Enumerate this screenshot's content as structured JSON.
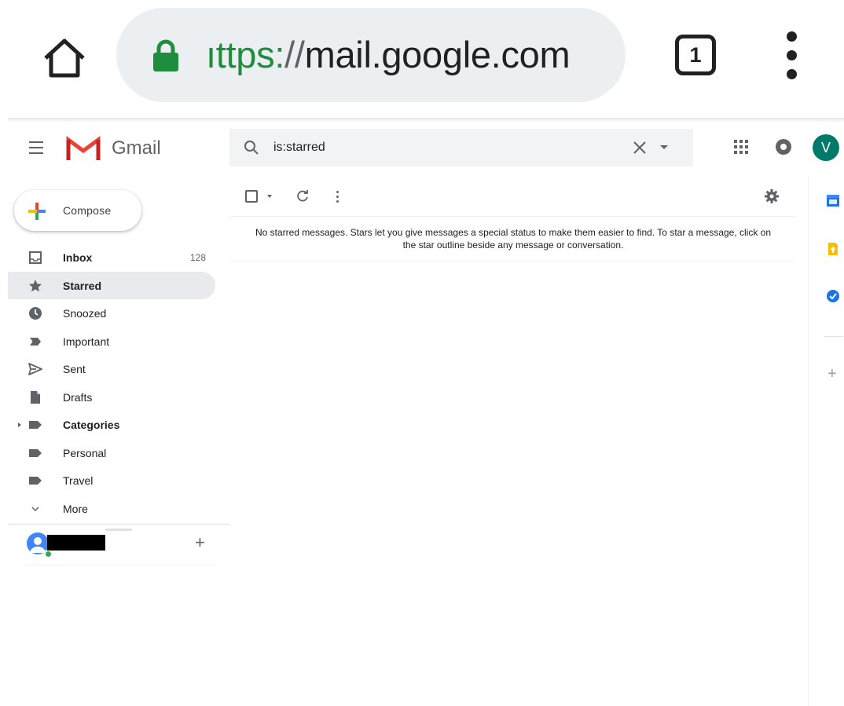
{
  "browser": {
    "url_scheme": "ıttps:",
    "url_separator": "//",
    "url_host": "mail.google.com",
    "tab_count": "1",
    "secure_color": "#1e8e3e"
  },
  "app": {
    "name": "Gmail",
    "logo_color": "#ea4335"
  },
  "search": {
    "value": "is:starred"
  },
  "header": {
    "avatar_initial": "V",
    "avatar_color": "#00796b"
  },
  "compose": {
    "label": "Compose"
  },
  "sidebar": {
    "items": [
      {
        "label": "Inbox",
        "count": "128",
        "icon": "inbox-icon",
        "bold": true,
        "active": false
      },
      {
        "label": "Starred",
        "count": "",
        "icon": "star-icon",
        "bold": true,
        "active": true
      },
      {
        "label": "Snoozed",
        "count": "",
        "icon": "clock-icon",
        "bold": false,
        "active": false
      },
      {
        "label": "Important",
        "count": "",
        "icon": "important-icon",
        "bold": false,
        "active": false
      },
      {
        "label": "Sent",
        "count": "",
        "icon": "send-icon",
        "bold": false,
        "active": false
      },
      {
        "label": "Drafts",
        "count": "",
        "icon": "draft-icon",
        "bold": false,
        "active": false
      },
      {
        "label": "Categories",
        "count": "",
        "icon": "label-icon",
        "bold": true,
        "active": false
      },
      {
        "label": "Personal",
        "count": "",
        "icon": "label-icon",
        "bold": false,
        "active": false
      },
      {
        "label": "Travel",
        "count": "",
        "icon": "label-icon",
        "bold": false,
        "active": false
      },
      {
        "label": "More",
        "count": "",
        "icon": "chevron-down-icon",
        "bold": false,
        "active": false
      }
    ]
  },
  "main": {
    "empty_message": "No starred messages. Stars let you give messages a special status to make them easier to find. To star a message, click on the star outline beside any message or conversation."
  },
  "hangouts": {
    "add_label": "+"
  },
  "side_panel": {
    "icons": [
      "calendar-icon",
      "keep-icon",
      "tasks-icon"
    ],
    "add_label": "+"
  }
}
